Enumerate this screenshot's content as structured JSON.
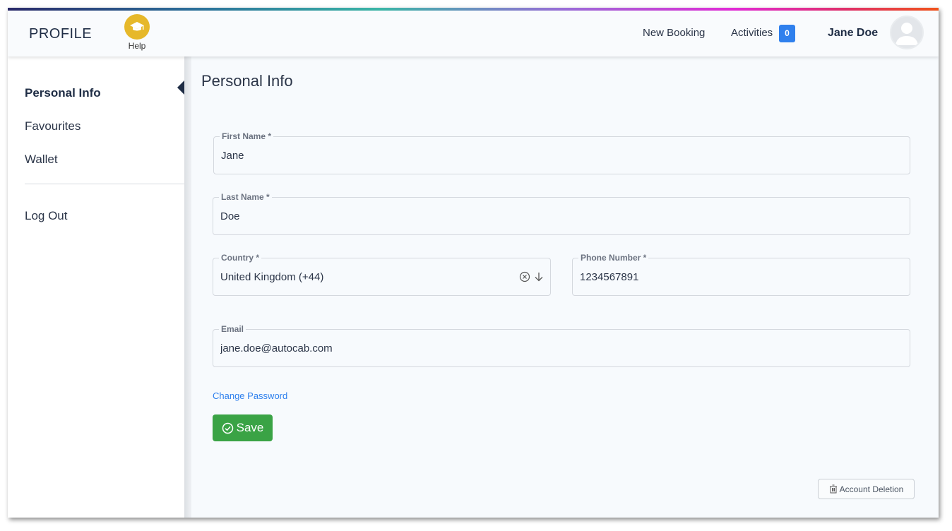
{
  "header": {
    "brand": "PROFILE",
    "help_label": "Help",
    "nav": {
      "new_booking": "New Booking",
      "activities": "Activities",
      "activities_count": "0"
    },
    "user_name": "Jane Doe"
  },
  "sidebar": {
    "items": [
      {
        "label": "Personal Info",
        "active": true
      },
      {
        "label": "Favourites",
        "active": false
      },
      {
        "label": "Wallet",
        "active": false
      }
    ],
    "logout": "Log Out"
  },
  "main": {
    "title": "Personal Info",
    "fields": {
      "first_name": {
        "label": "First Name *",
        "value": "Jane"
      },
      "last_name": {
        "label": "Last Name *",
        "value": "Doe"
      },
      "country": {
        "label": "Country *",
        "value": "United Kingdom (+44)"
      },
      "phone": {
        "label": "Phone Number *",
        "value": "1234567891"
      },
      "email": {
        "label": "Email",
        "value": "jane.doe@autocab.com"
      }
    },
    "change_password": "Change Password",
    "save": "Save",
    "account_deletion": "Account Deletion"
  },
  "colors": {
    "accent": "#2f80ed",
    "save": "#3aa345",
    "help": "#e6b82a"
  }
}
